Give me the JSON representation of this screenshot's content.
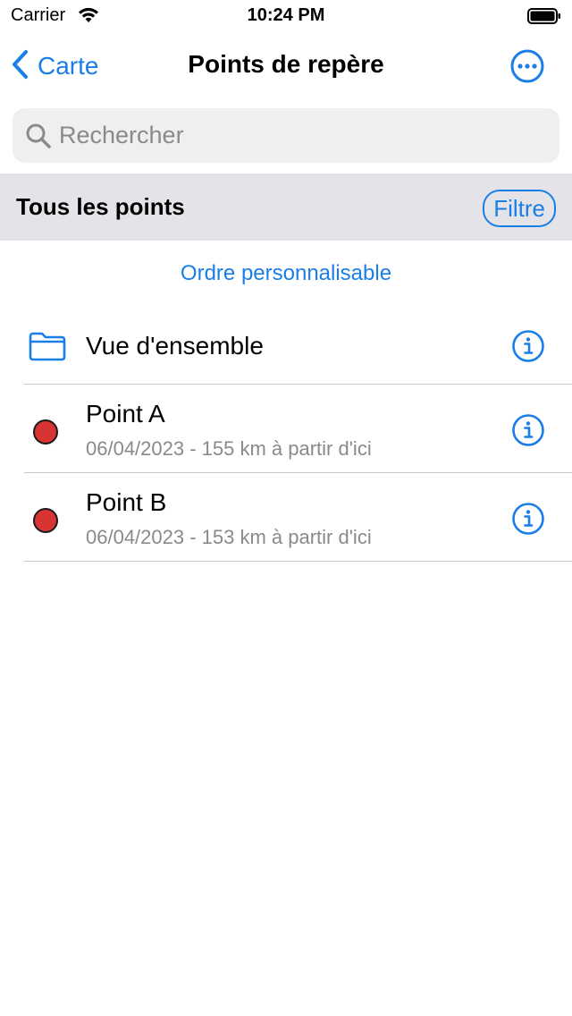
{
  "status_bar": {
    "carrier": "Carrier",
    "time": "10:24 PM"
  },
  "nav": {
    "back_label": "Carte",
    "title": "Points de repère"
  },
  "search": {
    "placeholder": "Rechercher",
    "value": ""
  },
  "section": {
    "title": "Tous les points",
    "filter_label": "Filtre"
  },
  "order_link": "Ordre personnalisable",
  "list": {
    "folder": {
      "title": "Vue d'ensemble",
      "icon": "folder-icon"
    },
    "points": [
      {
        "title": "Point A",
        "subtitle": "06/04/2023 - 155 km à partir d'ici",
        "color": "#d93434"
      },
      {
        "title": "Point B",
        "subtitle": "06/04/2023 - 153 km à partir d'ici",
        "color": "#d93434"
      }
    ]
  },
  "colors": {
    "accent": "#1a7ee8",
    "header_bg": "#e4e4e8",
    "search_bg": "#efeff0",
    "secondary_text": "#8a8a8e"
  }
}
